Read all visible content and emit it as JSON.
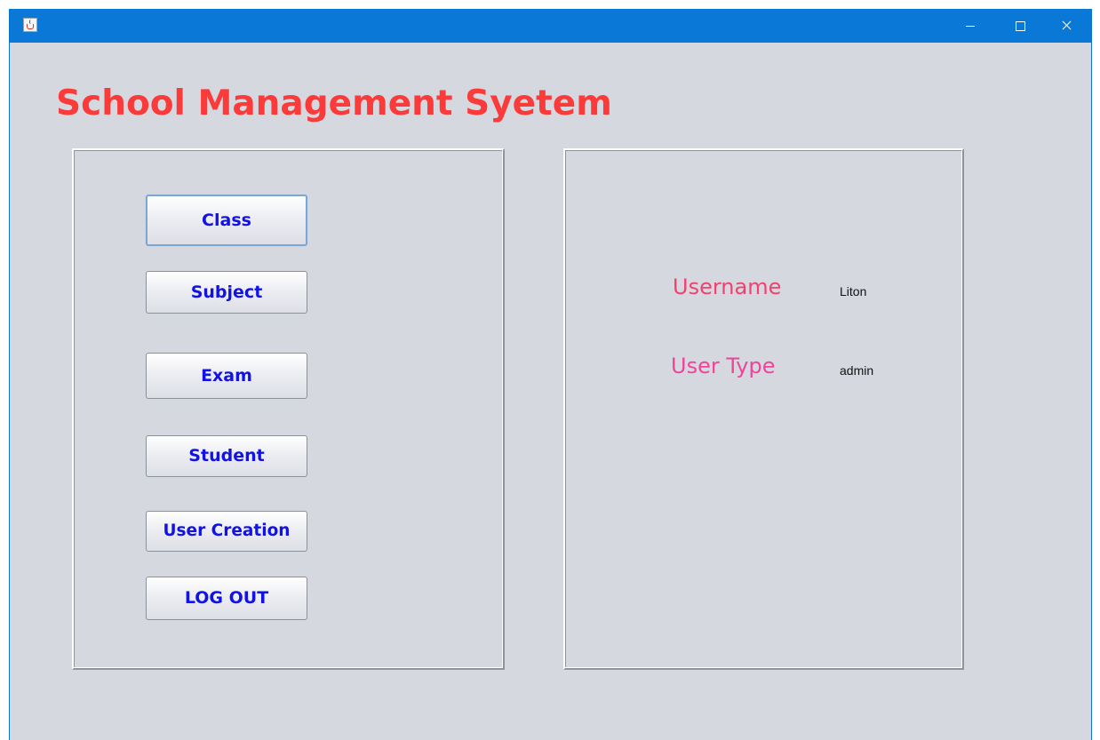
{
  "window": {
    "title": "",
    "controls": {
      "minimize_icon": "minimize-icon",
      "maximize_icon": "maximize-icon",
      "close_icon": "close-icon"
    },
    "titlebar_color": "#0a78d7"
  },
  "header": {
    "title": "School Management Syetem",
    "title_color": "#fb3a3a"
  },
  "nav": {
    "buttons": [
      {
        "label": "Class",
        "focused": true
      },
      {
        "label": "Subject"
      },
      {
        "label": "Exam"
      },
      {
        "label": "Student"
      },
      {
        "label": "User Creation"
      },
      {
        "label": "LOG OUT"
      }
    ],
    "label_color": "#1212e6"
  },
  "user_info": {
    "username_label": "Username",
    "username_value": "Liton",
    "user_type_label": "User Type",
    "user_type_value": "admin",
    "label_color": "#f2416e"
  }
}
